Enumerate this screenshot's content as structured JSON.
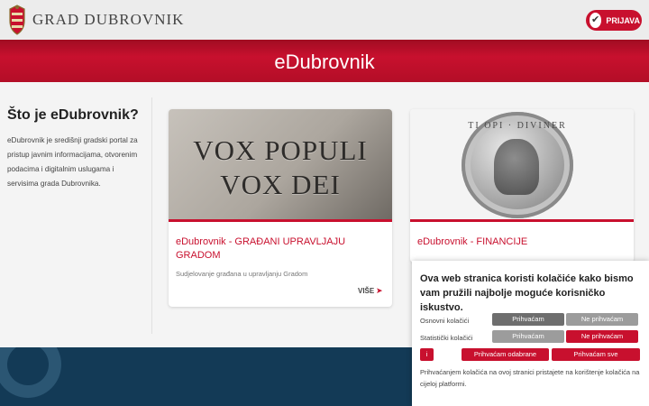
{
  "header": {
    "brand": "GRAD DUBROVNIK",
    "crest_icon": "crest-icon",
    "login_label": "PRIJAVA",
    "login_icon": "check-icon"
  },
  "hero": {
    "title": "eDubrovnik"
  },
  "sidebar": {
    "title": "Što je eDubrovnik?",
    "text": "eDubrovnik je središnji gradski portal za pristup javnim informacijama, otvorenim podacima i digitalnim uslugama i servisima grada Dubrovnika."
  },
  "cards": [
    {
      "image_text_1": "VOX POPULI",
      "image_text_2": "VOX DEI",
      "title": "eDubrovnik - GRAĐANI UPRAVLJAJU GRADOM",
      "subtitle": "Sudjelovanje građana u upravljanju Gradom",
      "more_label": "VIŠE",
      "more_icon": "chevron-right-icon"
    },
    {
      "image_text": "TI OPI · DIVINER",
      "title": "eDubrovnik - FINANCIJE"
    }
  ],
  "cookie": {
    "title": "Ova web stranica koristi kolačiće kako bismo vam pružili najbolje moguće korisničko iskustvo.",
    "rows": [
      {
        "label": "Osnovni kolačići",
        "accept": "Prihvaćam",
        "reject": "Ne prihvaćam"
      },
      {
        "label": "Statistički kolačići",
        "accept": "Prihvaćam",
        "reject": "Ne prihvaćam"
      }
    ],
    "info_label": "i",
    "accept_selected": "Prihvaćam odabrane",
    "accept_all": "Prihvaćam sve",
    "footer_text": "Prihvaćanjem kolačića na ovoj stranici pristajete na korištenje kolačića na cijeloj platformi."
  },
  "colors": {
    "accent": "#c8102e",
    "footer": "#133a56"
  }
}
